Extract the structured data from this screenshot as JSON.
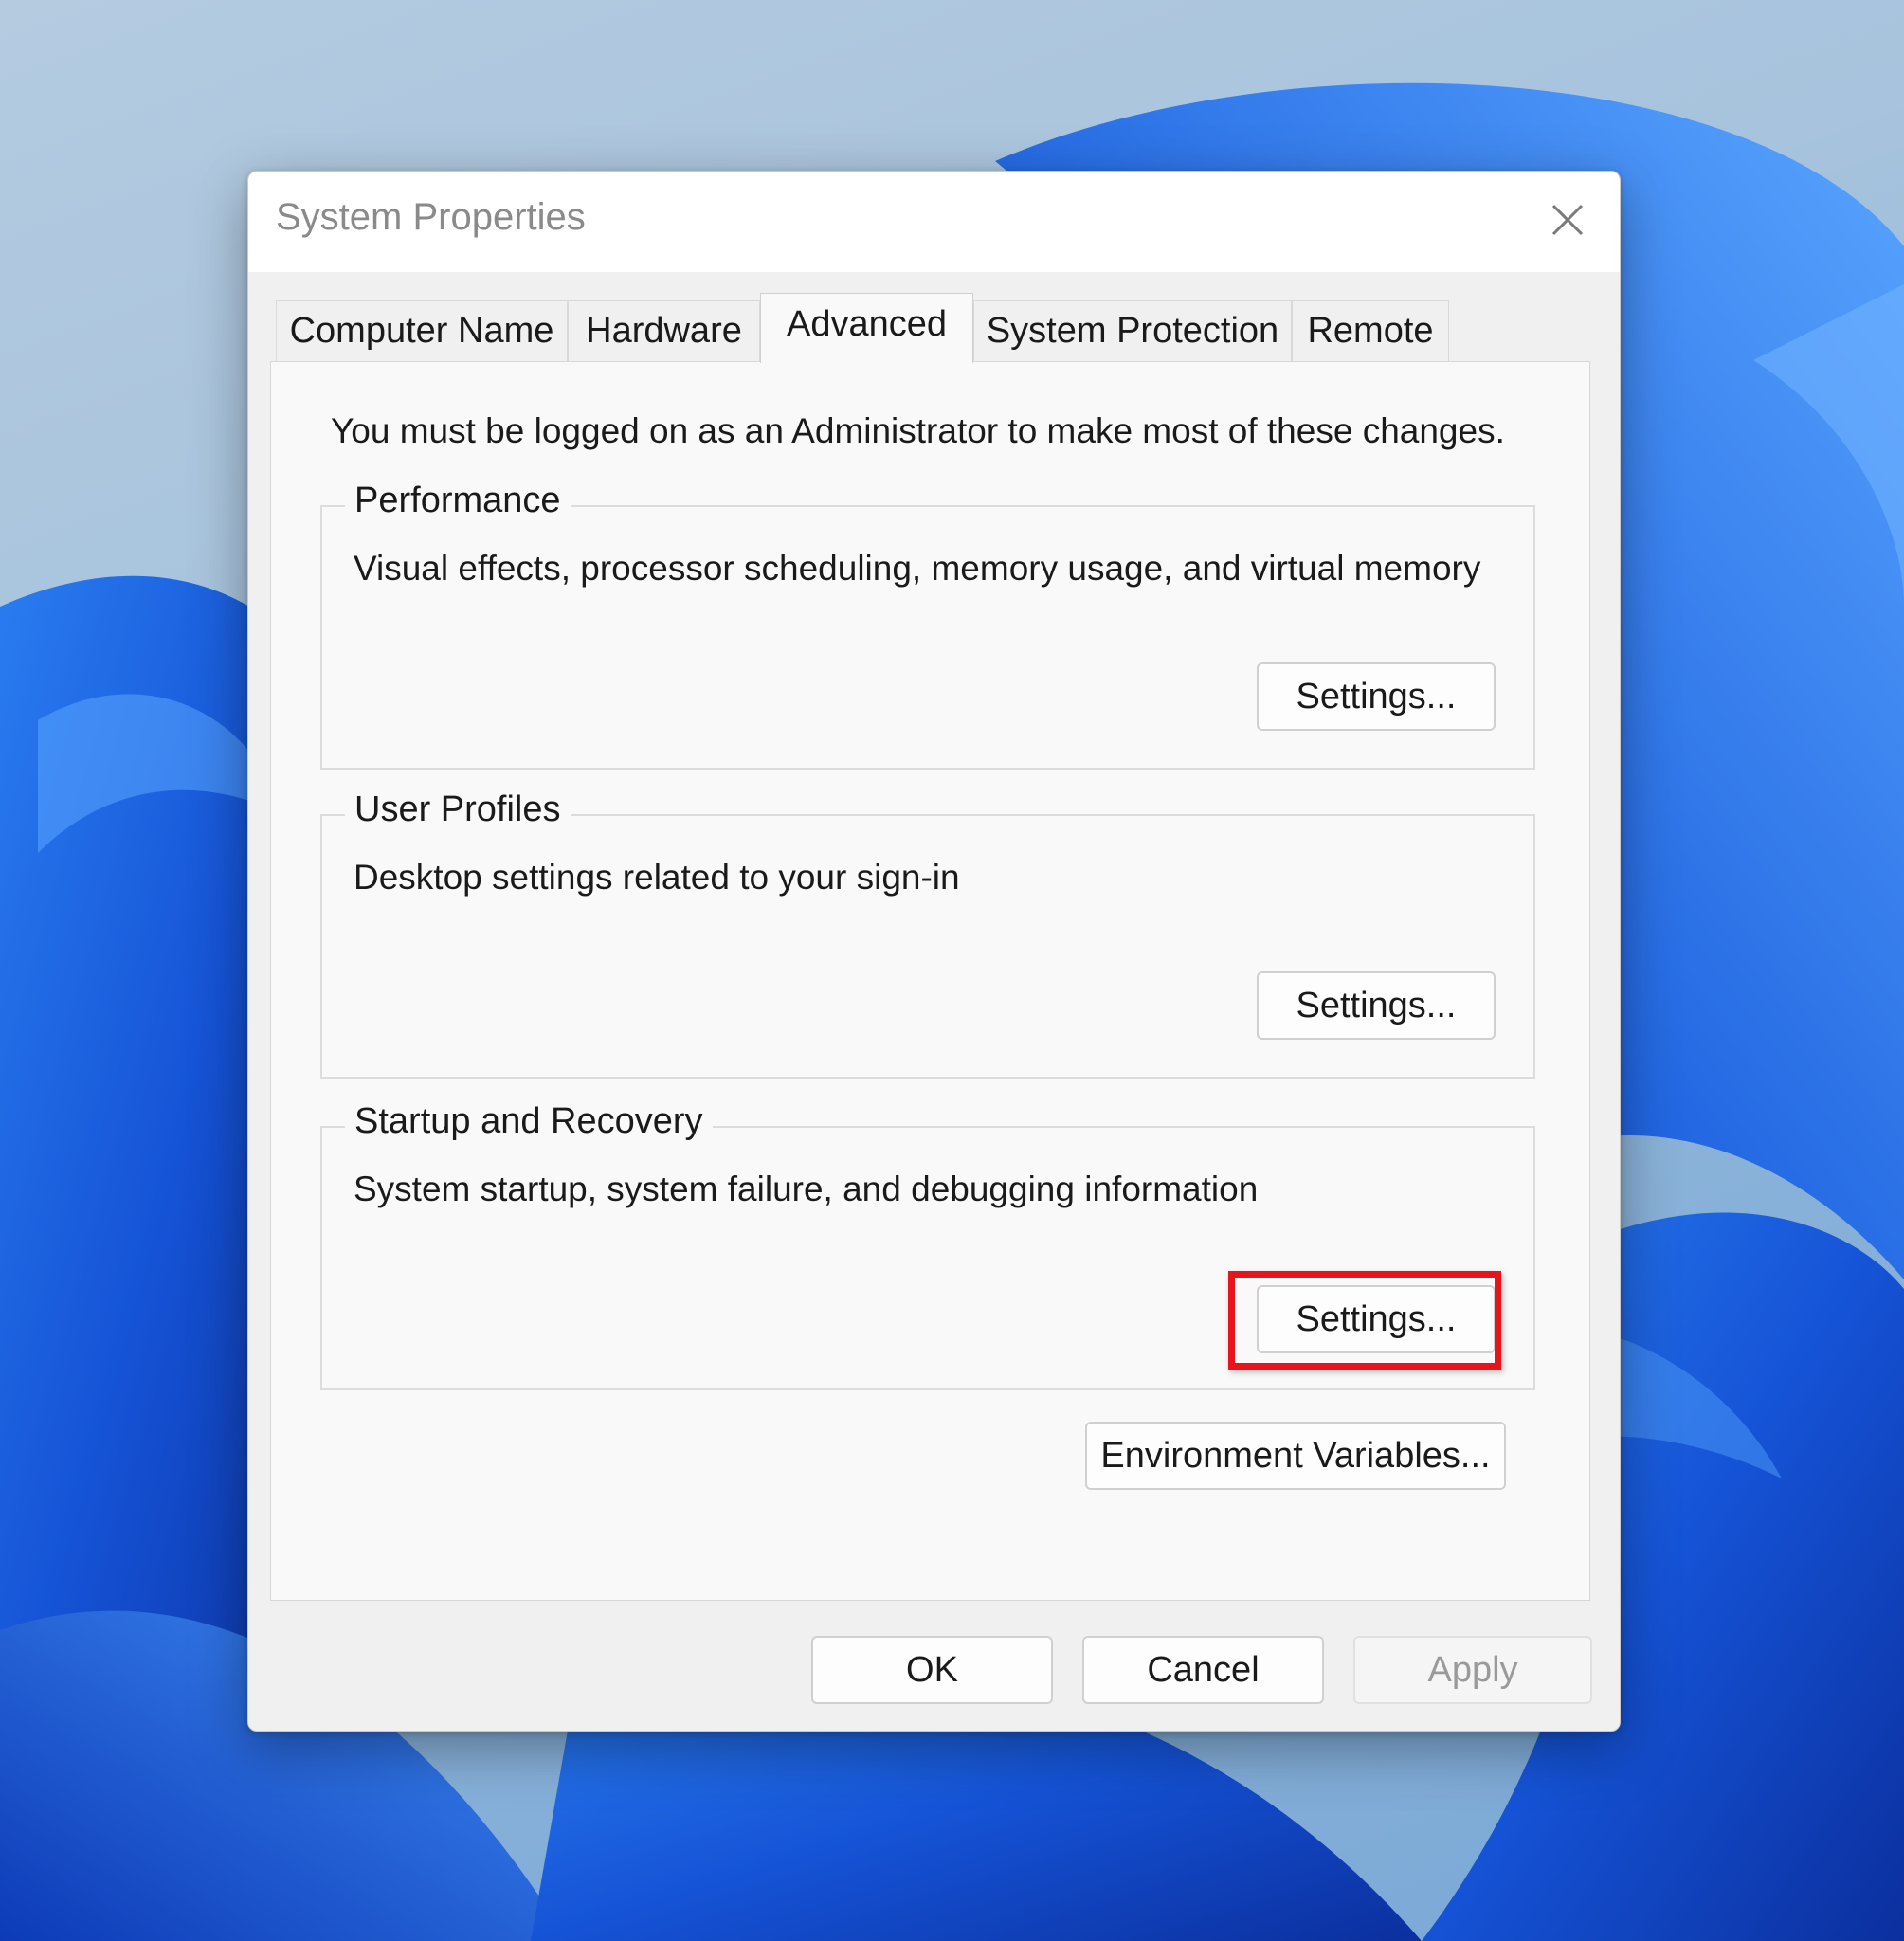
{
  "window": {
    "title": "System Properties",
    "close_icon": "close-icon"
  },
  "tabs": [
    {
      "label": "Computer Name",
      "active": false
    },
    {
      "label": "Hardware",
      "active": false
    },
    {
      "label": "Advanced",
      "active": true
    },
    {
      "label": "System Protection",
      "active": false
    },
    {
      "label": "Remote",
      "active": false
    }
  ],
  "advanced": {
    "admin_note": "You must be logged on as an Administrator to make most of these changes.",
    "performance": {
      "title": "Performance",
      "description": "Visual effects, processor scheduling, memory usage, and virtual memory",
      "button": "Settings..."
    },
    "user_profiles": {
      "title": "User Profiles",
      "description": "Desktop settings related to your sign-in",
      "button": "Settings..."
    },
    "startup_recovery": {
      "title": "Startup and Recovery",
      "description": "System startup, system failure, and debugging information",
      "button": "Settings..."
    },
    "environment_button": "Environment Variables..."
  },
  "footer": {
    "ok": "OK",
    "cancel": "Cancel",
    "apply": "Apply",
    "apply_disabled": true
  },
  "colors": {
    "highlight": "#e8141c",
    "wallpaper_blue": "#1f63e0"
  }
}
